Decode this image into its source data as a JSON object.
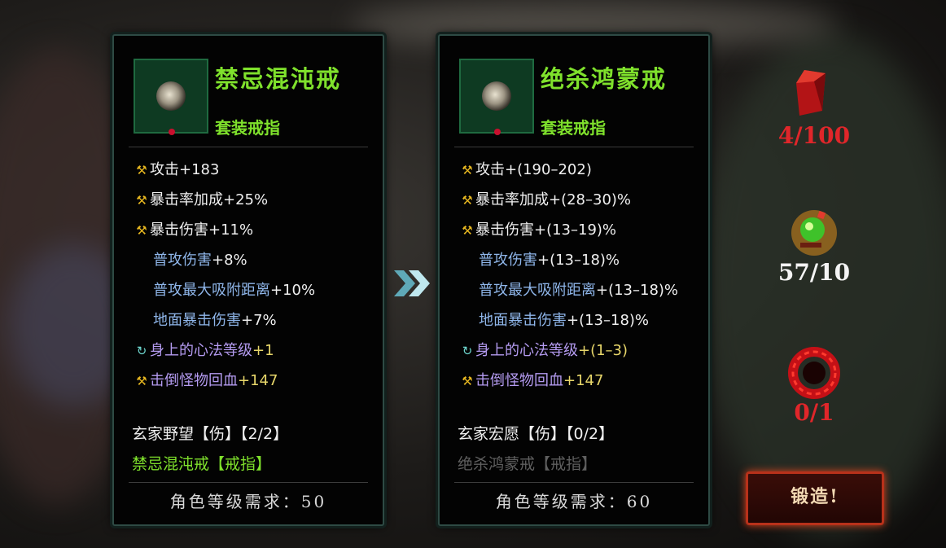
{
  "left_item": {
    "name": "禁忌混沌戒",
    "type": "套装戒指",
    "stats": [
      {
        "icon": "hammer-icon",
        "label": "攻击",
        "value": "+183",
        "style": "white"
      },
      {
        "icon": "hammer-icon",
        "label": "暴击率加成",
        "value": "+25%",
        "style": "white"
      },
      {
        "icon": "hammer-icon",
        "label": "暴击伤害",
        "value": "+11%",
        "style": "white"
      },
      {
        "icon": "",
        "label": "普攻伤害",
        "value": "+8%",
        "style": "blue"
      },
      {
        "icon": "",
        "label": "普攻最大吸附距离",
        "value": "+10%",
        "style": "blue"
      },
      {
        "icon": "",
        "label": "地面暴击伤害",
        "value": "+7%",
        "style": "blue"
      },
      {
        "icon": "cycle-icon",
        "label": "身上的心法等级",
        "value": "+1",
        "style": "purple"
      },
      {
        "icon": "hammer-icon",
        "label": "击倒怪物回血",
        "value": "+147",
        "style": "purple"
      }
    ],
    "set_name": "玄家野望【伤】【2/2】",
    "set_item": "禁忌混沌戒【戒指】",
    "requirement": "角色等级需求：50"
  },
  "right_item": {
    "name": "绝杀鸿蒙戒",
    "type": "套装戒指",
    "stats": [
      {
        "icon": "hammer-icon",
        "label": "攻击",
        "value": "+(190–202)",
        "style": "white"
      },
      {
        "icon": "hammer-icon",
        "label": "暴击率加成",
        "value": "+(28–30)%",
        "style": "white"
      },
      {
        "icon": "hammer-icon",
        "label": "暴击伤害",
        "value": "+(13–19)%",
        "style": "white"
      },
      {
        "icon": "",
        "label": "普攻伤害",
        "value": "+(13–18)%",
        "style": "blue"
      },
      {
        "icon": "",
        "label": "普攻最大吸附距离",
        "value": "+(13–18)%",
        "style": "blue"
      },
      {
        "icon": "",
        "label": "地面暴击伤害",
        "value": "+(13–18)%",
        "style": "blue"
      },
      {
        "icon": "cycle-icon",
        "label": "身上的心法等级",
        "value": "+(1–3)",
        "style": "purple"
      },
      {
        "icon": "hammer-icon",
        "label": "击倒怪物回血",
        "value": "+147",
        "style": "purple"
      }
    ],
    "set_name": "玄家宏愿【伤】【0/2】",
    "set_item": "绝杀鸿蒙戒【戒指】",
    "requirement": "角色等级需求：60"
  },
  "materials": [
    {
      "icon": "red-crystal-icon",
      "count": "4/100",
      "color": "red"
    },
    {
      "icon": "green-orb-icon",
      "count": "57/10",
      "color": "white"
    },
    {
      "icon": "red-ring-icon",
      "count": "0/1",
      "color": "red"
    }
  ],
  "forge_button": "锻造!",
  "colors": {
    "accent_green": "#7fe12c",
    "stat_blue": "#8fb6ea",
    "stat_purple": "#b49bf0",
    "warning_red": "#e0262a"
  }
}
